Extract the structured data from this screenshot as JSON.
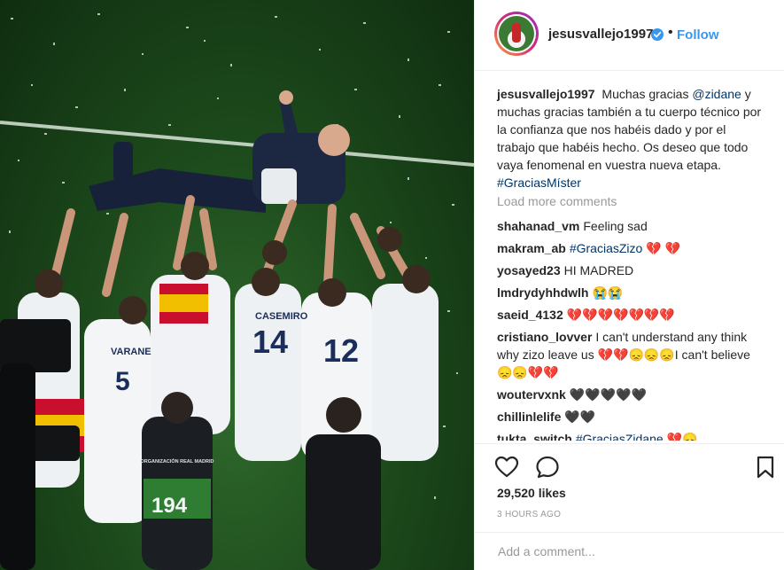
{
  "post": {
    "username": "jesusvallejo1997",
    "follow_label": "Follow",
    "separator": "•",
    "caption_user": "jesusvallejo1997",
    "caption_pre": "Muchas gracias",
    "caption_mention": "@zidane",
    "caption_mid": "y muchas gracias también a tu cuerpo técnico por la confianza que nos habéis dado y por el trabajo que habéis hecho. Os deseo que todo vaya fenomenal en vuestra nueva etapa.",
    "caption_tag": "#GraciasMíster",
    "load_more": "Load more comments",
    "likes": "29,520 likes",
    "time": "3 HOURS AGO",
    "add_comment_placeholder": "Add a comment..."
  },
  "comments": [
    {
      "user": "shahanad_vm",
      "text": "Feeling sad",
      "highlight": ""
    },
    {
      "user": "makram_ab",
      "text": "",
      "highlight": "#GraciasZizo",
      "emoji": "💔 💔"
    },
    {
      "user": "yosayed23",
      "text": "HI MADRED",
      "highlight": ""
    },
    {
      "user": "lmdrydyhhdwlh",
      "text": "",
      "highlight": "",
      "emoji": "😭😭"
    },
    {
      "user": "saeid_4132",
      "text": "",
      "highlight": "",
      "emoji": "💔💔💔💔💔💔💔"
    },
    {
      "user": "cristiano_lovver",
      "text": "I can't understand any think why zizo leave us 💔💔😞😞😞I can't believe 😞😞💔💔",
      "highlight": ""
    },
    {
      "user": "woutervxnk",
      "text": "",
      "highlight": "",
      "emoji": "🖤🖤🖤🖤🖤"
    },
    {
      "user": "chillinlelife",
      "text": "",
      "highlight": "",
      "emoji": "🖤🖤"
    },
    {
      "user": "tukta_switch",
      "text": "",
      "highlight": "#GraciasZidane",
      "emoji": "💔😞"
    }
  ],
  "photo": {
    "jersey_numbers": [
      "14",
      "12",
      "5",
      "194"
    ],
    "jersey_names": [
      "CASEMIRO",
      "VARANE"
    ],
    "vest_text": "ORGANIZACIÓN REAL MADRID"
  },
  "icons": [
    "heart-icon",
    "comment-icon",
    "bookmark-icon",
    "verified-icon"
  ],
  "colors": {
    "link": "#3897f0",
    "hashtag": "#003569",
    "muted": "#999999",
    "verified": "#3897f0"
  }
}
